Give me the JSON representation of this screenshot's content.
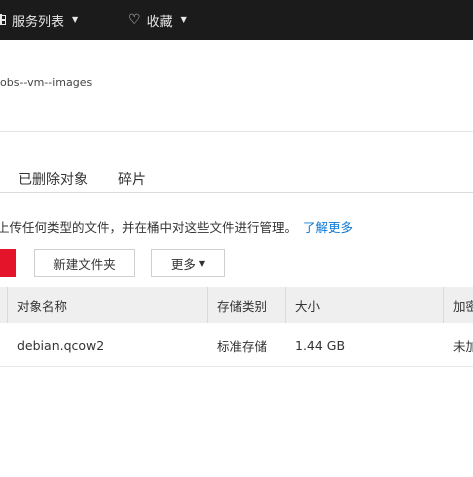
{
  "topbar": {
    "services_label": "服务列表",
    "favorites_label": "收藏"
  },
  "bucket": {
    "name": "obs--vm--images"
  },
  "tabs": [
    {
      "label": "已删除对象"
    },
    {
      "label": "碎片"
    }
  ],
  "intro": {
    "text": "上传任何类型的文件，并在桶中对这些文件进行管理。",
    "link": "了解更多"
  },
  "toolbar": {
    "new_folder_label": "新建文件夹",
    "more_label": "更多"
  },
  "table": {
    "columns": [
      "对象名称",
      "存储类别",
      "大小",
      "加密"
    ],
    "rows": [
      {
        "name": "debian.qcow2",
        "storage_class": "标准存储",
        "size": "1.44 GB",
        "encryption": "未加"
      }
    ]
  },
  "colors": {
    "topbar_bg": "#1b1b1b",
    "accent_red": "#e4142b",
    "link_blue": "#0b78d4",
    "table_header_bg": "#efefef"
  },
  "icons": {
    "services": "grid-icon",
    "favorites": "heart-icon",
    "dropdown": "caret-down-icon"
  }
}
